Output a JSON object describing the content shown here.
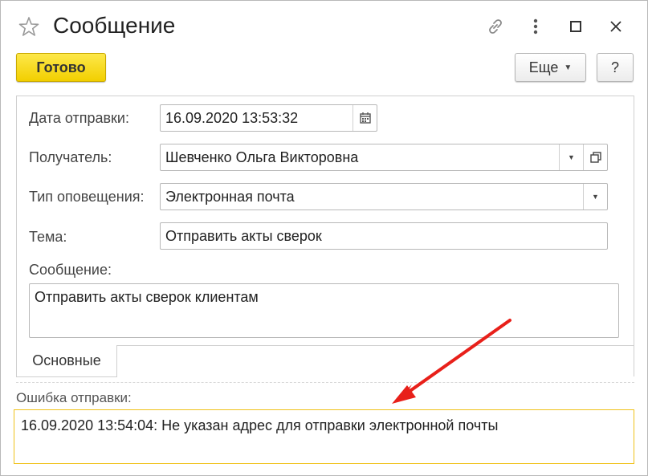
{
  "window": {
    "title": "Сообщение"
  },
  "toolbar": {
    "done_label": "Готово",
    "more_label": "Еще",
    "help_label": "?"
  },
  "form": {
    "date_label": "Дата отправки:",
    "date_value": "16.09.2020 13:53:32",
    "recipient_label": "Получатель:",
    "recipient_value": "Шевченко Ольга Викторовна",
    "notify_type_label": "Тип оповещения:",
    "notify_type_value": "Электронная почта",
    "subject_label": "Тема:",
    "subject_value": "Отправить акты сверок",
    "message_label": "Сообщение:",
    "message_value": "Отправить акты сверок клиентам"
  },
  "tabs": [
    {
      "label": "Основные"
    }
  ],
  "error": {
    "label": "Ошибка отправки:",
    "text": "16.09.2020 13:54:04: Не указан адрес для отправки электронной почты"
  },
  "colors": {
    "primary_button": "#f2cf00",
    "error_border": "#f0c21a",
    "arrow": "#e8201a"
  },
  "icons": [
    "star-icon",
    "link-icon",
    "more-vertical-icon",
    "maximize-icon",
    "close-icon",
    "calendar-icon",
    "dropdown-icon",
    "open-form-icon"
  ]
}
